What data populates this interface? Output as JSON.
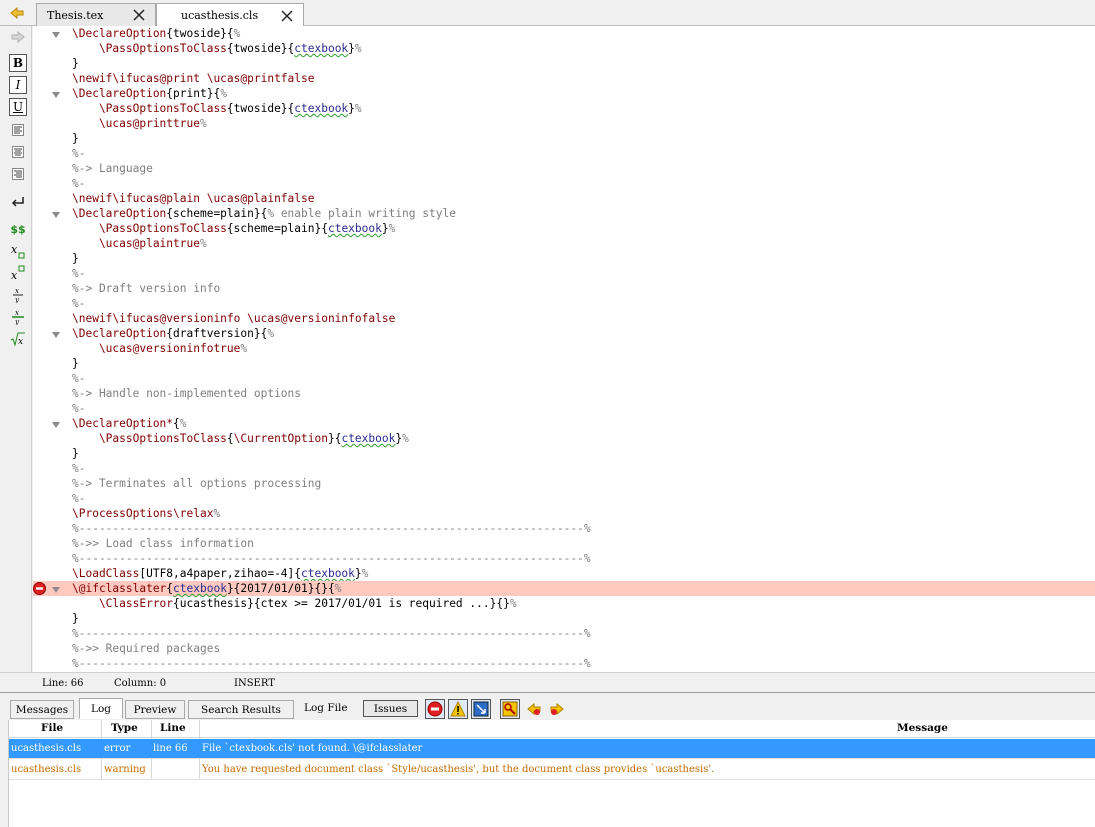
{
  "tabs": [
    {
      "label": "Thesis.tex",
      "active": false
    },
    {
      "label": "ucasthesis.cls",
      "active": true
    }
  ],
  "toolbar": {
    "bold": "B",
    "italic": "I",
    "underline": "U",
    "math": "$$"
  },
  "editor": {
    "highlight_color": "#ffc9c0",
    "lines": [
      {
        "fold": true,
        "parts": [
          [
            "cmd",
            "\\DeclareOption"
          ],
          [
            "arg",
            "{twoside}{"
          ],
          [
            "cm",
            "%"
          ]
        ]
      },
      {
        "fold": false,
        "parts": [
          [
            "cmd",
            "    \\PassOptionsToClass"
          ],
          [
            "arg",
            "{twoside}{"
          ],
          [
            "sq",
            "ctexbook"
          ],
          [
            "arg",
            "}"
          ],
          [
            "cm",
            "%"
          ]
        ]
      },
      {
        "fold": false,
        "parts": [
          [
            "arg",
            "}"
          ]
        ]
      },
      {
        "fold": false,
        "parts": [
          [
            "cmd",
            "\\newif\\ifucas@print \\ucas@printfalse"
          ]
        ]
      },
      {
        "fold": true,
        "parts": [
          [
            "cmd",
            "\\DeclareOption"
          ],
          [
            "arg",
            "{print}{"
          ],
          [
            "cm",
            "%"
          ]
        ]
      },
      {
        "fold": false,
        "parts": [
          [
            "cmd",
            "    \\PassOptionsToClass"
          ],
          [
            "arg",
            "{twoside}{"
          ],
          [
            "sq",
            "ctexbook"
          ],
          [
            "arg",
            "}"
          ],
          [
            "cm",
            "%"
          ]
        ]
      },
      {
        "fold": false,
        "parts": [
          [
            "cmd",
            "    \\ucas@printtrue"
          ],
          [
            "cm",
            "%"
          ]
        ]
      },
      {
        "fold": false,
        "parts": [
          [
            "arg",
            "}"
          ]
        ]
      },
      {
        "fold": false,
        "parts": [
          [
            "cm",
            "%-"
          ]
        ]
      },
      {
        "fold": false,
        "parts": [
          [
            "cm",
            "%-> Language"
          ]
        ]
      },
      {
        "fold": false,
        "parts": [
          [
            "cm",
            "%-"
          ]
        ]
      },
      {
        "fold": false,
        "parts": [
          [
            "cmd",
            "\\newif\\ifucas@plain \\ucas@plainfalse"
          ]
        ]
      },
      {
        "fold": true,
        "parts": [
          [
            "cmd",
            "\\DeclareOption"
          ],
          [
            "arg",
            "{scheme=plain}{"
          ],
          [
            "cm",
            "% enable plain writing style"
          ]
        ]
      },
      {
        "fold": false,
        "parts": [
          [
            "cmd",
            "    \\PassOptionsToClass"
          ],
          [
            "arg",
            "{scheme=plain}{"
          ],
          [
            "sq",
            "ctexbook"
          ],
          [
            "arg",
            "}"
          ],
          [
            "cm",
            "%"
          ]
        ]
      },
      {
        "fold": false,
        "parts": [
          [
            "cmd",
            "    \\ucas@plaintrue"
          ],
          [
            "cm",
            "%"
          ]
        ]
      },
      {
        "fold": false,
        "parts": [
          [
            "arg",
            "}"
          ]
        ]
      },
      {
        "fold": false,
        "parts": [
          [
            "cm",
            "%-"
          ]
        ]
      },
      {
        "fold": false,
        "parts": [
          [
            "cm",
            "%-> Draft version info"
          ]
        ]
      },
      {
        "fold": false,
        "parts": [
          [
            "cm",
            "%-"
          ]
        ]
      },
      {
        "fold": false,
        "parts": [
          [
            "cmd",
            "\\newif\\ifucas@versioninfo \\ucas@versioninfofalse"
          ]
        ]
      },
      {
        "fold": true,
        "parts": [
          [
            "cmd",
            "\\DeclareOption"
          ],
          [
            "arg",
            "{draftversion}{"
          ],
          [
            "cm",
            "%"
          ]
        ]
      },
      {
        "fold": false,
        "parts": [
          [
            "cmd",
            "    \\ucas@versioninfotrue"
          ],
          [
            "cm",
            "%"
          ]
        ]
      },
      {
        "fold": false,
        "parts": [
          [
            "arg",
            "}"
          ]
        ]
      },
      {
        "fold": false,
        "parts": [
          [
            "cm",
            "%-"
          ]
        ]
      },
      {
        "fold": false,
        "parts": [
          [
            "cm",
            "%-> Handle non-implemented options"
          ]
        ]
      },
      {
        "fold": false,
        "parts": [
          [
            "cm",
            "%-"
          ]
        ]
      },
      {
        "fold": true,
        "parts": [
          [
            "cmd",
            "\\DeclareOption*"
          ],
          [
            "arg",
            "{"
          ],
          [
            "cm",
            "%"
          ]
        ]
      },
      {
        "fold": false,
        "parts": [
          [
            "cmd",
            "    \\PassOptionsToClass"
          ],
          [
            "arg",
            "{"
          ],
          [
            "cmd",
            "\\CurrentOption"
          ],
          [
            "arg",
            "}{"
          ],
          [
            "sq",
            "ctexbook"
          ],
          [
            "arg",
            "}"
          ],
          [
            "cm",
            "%"
          ]
        ]
      },
      {
        "fold": false,
        "parts": [
          [
            "arg",
            "}"
          ]
        ]
      },
      {
        "fold": false,
        "parts": [
          [
            "cm",
            "%-"
          ]
        ]
      },
      {
        "fold": false,
        "parts": [
          [
            "cm",
            "%-> Terminates all options processing"
          ]
        ]
      },
      {
        "fold": false,
        "parts": [
          [
            "cm",
            "%-"
          ]
        ]
      },
      {
        "fold": false,
        "parts": [
          [
            "cmd",
            "\\ProcessOptions\\relax"
          ],
          [
            "cm",
            "%"
          ]
        ]
      },
      {
        "fold": false,
        "parts": [
          [
            "cm",
            "%---------------------------------------------------------------------------%"
          ]
        ]
      },
      {
        "fold": false,
        "parts": [
          [
            "cm",
            "%->> Load class information"
          ]
        ]
      },
      {
        "fold": false,
        "parts": [
          [
            "cm",
            "%---------------------------------------------------------------------------%"
          ]
        ]
      },
      {
        "fold": false,
        "parts": [
          [
            "cmd",
            "\\LoadClass"
          ],
          [
            "arg",
            "[UTF8,a4paper,zihao=-4]{"
          ],
          [
            "sq",
            "ctexbook"
          ],
          [
            "arg",
            "}"
          ],
          [
            "cm",
            "%"
          ]
        ]
      },
      {
        "fold": true,
        "error": true,
        "parts": [
          [
            "cmd",
            "\\@ifclasslater"
          ],
          [
            "arg",
            "{"
          ],
          [
            "sq",
            "ctexbook"
          ],
          [
            "arg",
            "}{2017/01/01}{}{"
          ],
          [
            "cm",
            "%"
          ]
        ]
      },
      {
        "fold": false,
        "parts": [
          [
            "cmd",
            "    \\ClassError"
          ],
          [
            "arg",
            "{ucasthesis}{ctex >= 2017/01/01 is required ...}{}"
          ],
          [
            "cm",
            "%"
          ]
        ]
      },
      {
        "fold": false,
        "parts": [
          [
            "arg",
            "}"
          ]
        ]
      },
      {
        "fold": false,
        "parts": [
          [
            "cm",
            "%---------------------------------------------------------------------------%"
          ]
        ]
      },
      {
        "fold": false,
        "parts": [
          [
            "cm",
            "%->> Required packages"
          ]
        ]
      },
      {
        "fold": false,
        "parts": [
          [
            "cm",
            "%---------------------------------------------------------------------------%"
          ]
        ]
      }
    ]
  },
  "status": {
    "line": "Line: 66",
    "column": "Column: 0",
    "mode": "INSERT"
  },
  "panel": {
    "tabs": [
      "Messages",
      "Log",
      "Preview",
      "Search Results"
    ],
    "active_tab": "Log",
    "log_file_label": "Log File",
    "issues_label": "Issues",
    "columns": [
      "File",
      "Type",
      "Line",
      "Message"
    ],
    "rows": [
      {
        "file": "ucasthesis.cls",
        "type": "error",
        "line": "line 66",
        "message": "File `ctexbook.cls' not found. \\@ifclasslater",
        "selected": true
      },
      {
        "file": "ucasthesis.cls",
        "type": "warning",
        "line": "",
        "message": "You have requested document class `Style/ucasthesis', but the document class provides `ucasthesis'.",
        "selected": false
      }
    ],
    "selected_color": "#3399ff",
    "warning_color": "#c46a00"
  }
}
